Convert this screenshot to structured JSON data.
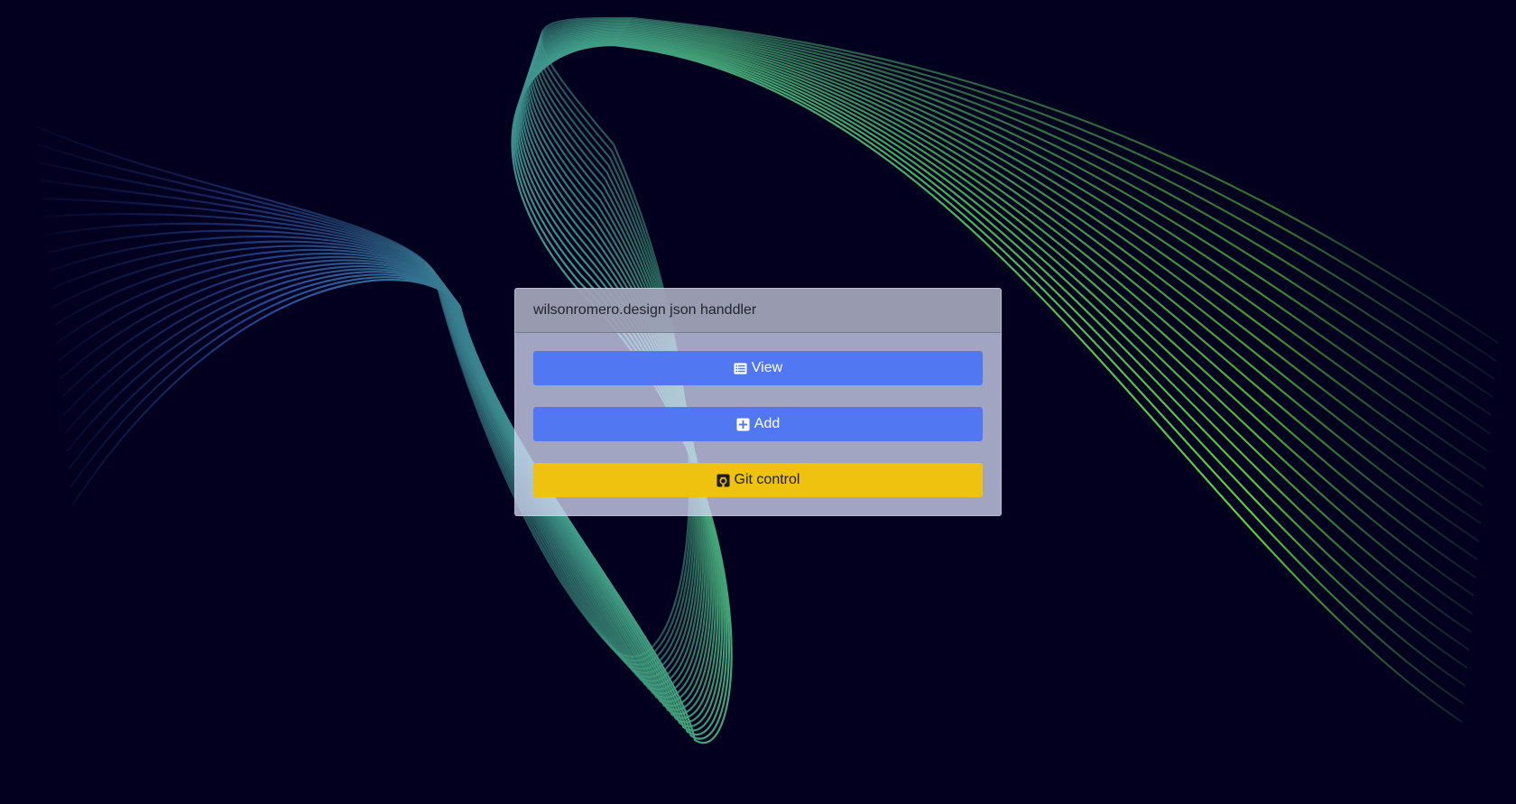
{
  "app": {
    "title": "wilsonromero.design json handdler"
  },
  "actions": {
    "view_label": "View",
    "add_label": "Add",
    "git_label": "Git control"
  },
  "icons": {
    "view": "list-icon",
    "add": "plus-square-icon",
    "git": "github-icon"
  },
  "colors": {
    "background": "#03001f",
    "primary_button": "#5277f3",
    "warning_button": "#efc20f",
    "wave_green": "#58d13a",
    "wave_blue": "#2a4fa0",
    "wave_teal": "#3f9a8a"
  }
}
